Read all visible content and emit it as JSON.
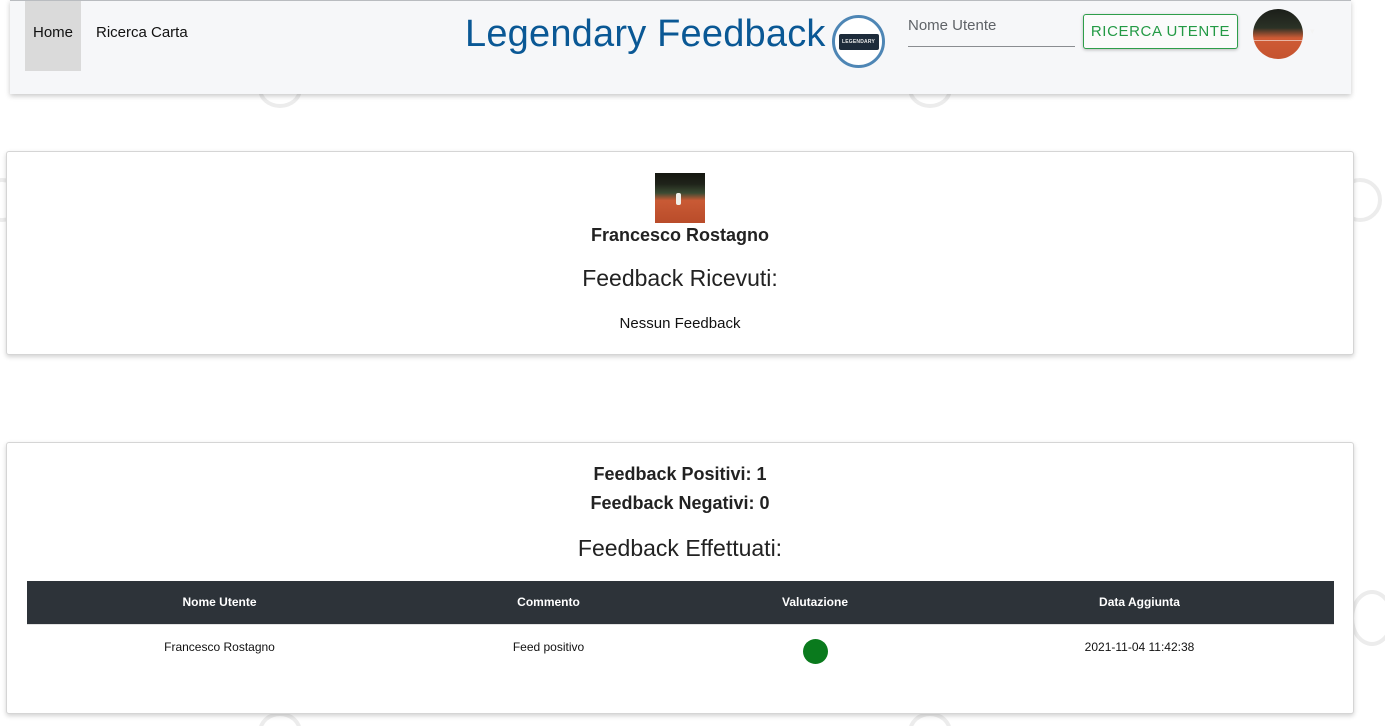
{
  "navbar": {
    "home_label": "Home",
    "ricerca_label": "Ricerca Carta",
    "brand_title": "Legendary Feedback",
    "brand_logo_text": "LEGENDARY",
    "search_placeholder": "Nome Utente",
    "search_button_label": "RICERCA UTENTE",
    "caret": "▾"
  },
  "profile": {
    "name": "Francesco Rostagno",
    "received_title": "Feedback Ricevuti:",
    "no_feedback_text": "Nessun Feedback"
  },
  "stats": {
    "positive_text": "Feedback Positivi: 1",
    "negative_text": "Feedback Negativi: 0",
    "given_title": "Feedback Effettuati:"
  },
  "table": {
    "headers": [
      "Nome Utente",
      "Commento",
      "Valutazione",
      "Data Aggiunta"
    ],
    "rows": [
      {
        "user": "Francesco Rostagno",
        "comment": "Feed positivo",
        "rating": "positive",
        "rating_color": "#0a7a1d",
        "date": "2021-11-04 11:42:38"
      }
    ]
  },
  "colors": {
    "brand": "#0a5895",
    "search_button": "#239a45",
    "table_header": "#2d3339",
    "positive": "#0a7a1d"
  },
  "icons": {
    "background_pattern": "ring-icon",
    "rating": "dot-icon"
  }
}
